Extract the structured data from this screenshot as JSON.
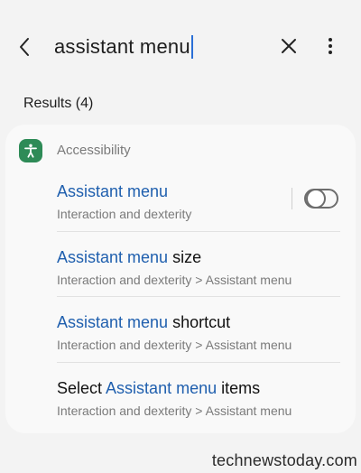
{
  "search": {
    "query": "assistant menu",
    "back_icon": "back-arrow-icon",
    "clear_icon": "close-icon",
    "more_icon": "more-vertical-icon"
  },
  "results": {
    "header": "Results (4)",
    "category": {
      "label": "Accessibility",
      "icon": "accessibility-icon",
      "icon_color": "#2e8b57"
    },
    "items": [
      {
        "title_pre": "",
        "title_hl": "Assistant menu",
        "title_post": "",
        "subtitle": "Interaction and dexterity",
        "toggle": "off"
      },
      {
        "title_pre": "",
        "title_hl": "Assistant menu",
        "title_post": " size",
        "subtitle": "Interaction and dexterity > Assistant menu"
      },
      {
        "title_pre": "",
        "title_hl": "Assistant menu",
        "title_post": " shortcut",
        "subtitle": "Interaction and dexterity > Assistant menu"
      },
      {
        "title_pre": "Select ",
        "title_hl": "Assistant menu",
        "title_post": " items",
        "subtitle": "Interaction and dexterity > Assistant menu"
      }
    ]
  },
  "highlight_color": "#1f5fae",
  "watermark": "technewstoday.com"
}
